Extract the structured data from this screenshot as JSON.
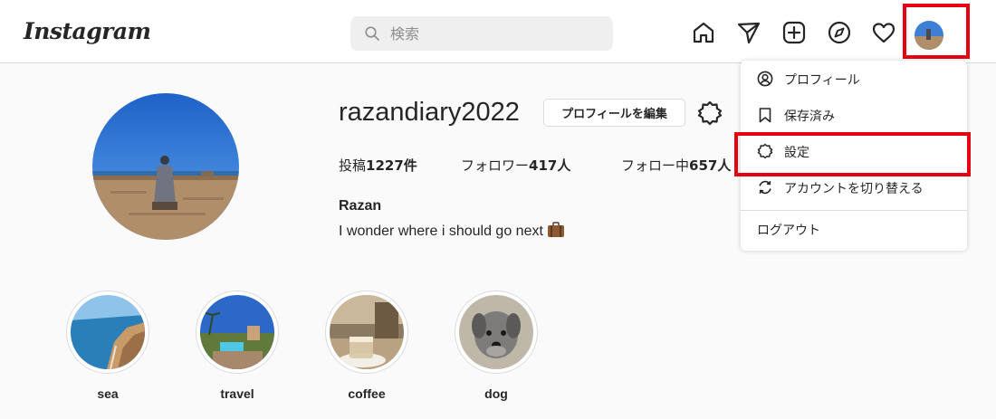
{
  "header": {
    "logo": "Instagram",
    "search_placeholder": "検索",
    "nav_icons": [
      "home-icon",
      "direct-message-icon",
      "new-post-icon",
      "explore-icon",
      "activity-heart-icon",
      "profile-avatar"
    ]
  },
  "profile": {
    "username": "razandiary2022",
    "edit_button": "プロフィールを編集",
    "stats": {
      "posts_label": "投稿",
      "posts_value": "1227件",
      "followers_label": "フォロワー",
      "followers_value": "417人",
      "following_label": "フォロー中",
      "following_value": "657人"
    },
    "full_name": "Razan",
    "bio": "I wonder where i should go next"
  },
  "highlights": [
    {
      "label": "sea"
    },
    {
      "label": "travel"
    },
    {
      "label": "coffee"
    },
    {
      "label": "dog"
    }
  ],
  "menu": {
    "items": [
      {
        "label": "プロフィール",
        "icon": "profile-icon"
      },
      {
        "label": "保存済み",
        "icon": "bookmark-icon"
      },
      {
        "label": "設定",
        "icon": "settings-icon"
      },
      {
        "label": "アカウントを切り替える",
        "icon": "switch-account-icon"
      }
    ],
    "logout": "ログアウト"
  },
  "colors": {
    "highlight_box": "#e60012",
    "background": "#fafafa",
    "border": "#dbdbdb"
  }
}
